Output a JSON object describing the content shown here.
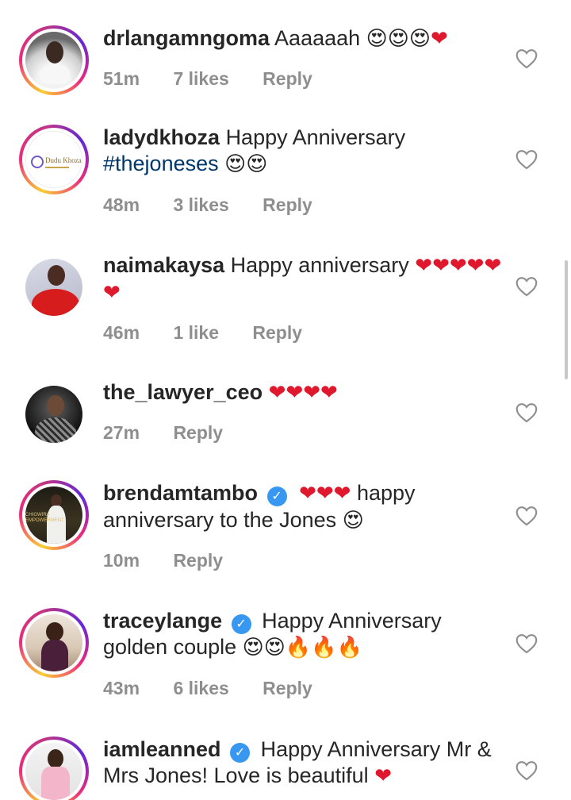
{
  "comments": [
    {
      "username": "drlangamngoma",
      "text": "Aaaaaah",
      "emojis": "😍😍😍❤️",
      "time": "51m",
      "likes": "7 likes",
      "reply": "Reply",
      "avatar_icon": "profile-photo-woman-white-dress",
      "story_ring": true
    },
    {
      "username": "ladydkhoza",
      "text": "Happy Anniversary",
      "hashtag": "#thejoneses",
      "emojis": "😍😍",
      "time": "48m",
      "likes": "3 likes",
      "reply": "Reply",
      "avatar_icon": "logo-dk-khoza",
      "avatar_logo_text": "Dudu Khoza",
      "story_ring": true
    },
    {
      "username": "naimakaysa",
      "text": "Happy anniversary",
      "emojis": "❤️❤️❤️❤️❤️❤️",
      "time": "46m",
      "likes": "1 like",
      "reply": "Reply",
      "avatar_icon": "profile-photo-woman-red-dress",
      "story_ring": false
    },
    {
      "username": "the_lawyer_ceo",
      "emojis": "❤️❤️❤️❤️",
      "time": "27m",
      "reply": "Reply",
      "avatar_icon": "profile-photo-woman-dark",
      "story_ring": false
    },
    {
      "username": "brendamtambo",
      "verified": true,
      "emojis": "❤️❤️❤️",
      "text": "happy anniversary to the Jones",
      "emojis_after": "😍",
      "time": "10m",
      "reply": "Reply",
      "avatar_icon": "profile-photo-woman-white-gown",
      "avatar_overlay_text": "CHIGWIRA EMPOWERMENT",
      "story_ring": true
    },
    {
      "username": "traceylange",
      "verified": true,
      "text": "Happy Anniversary golden couple",
      "emojis": "😍😍🔥🔥🔥",
      "time": "43m",
      "likes": "6 likes",
      "reply": "Reply",
      "avatar_icon": "profile-photo-woman-seated",
      "story_ring": true
    },
    {
      "username": "iamleanned",
      "verified": true,
      "text": "Happy Anniversary Mr & Mrs Jones! Love is beautiful",
      "emojis": "❤️",
      "avatar_icon": "profile-photo-woman-pink-suit",
      "story_ring": true
    }
  ],
  "colors": {
    "username": "#262626",
    "meta": "#8e8e8e",
    "hashtag": "#00376b",
    "verified": "#3897f0",
    "heart": "#e0182d"
  }
}
